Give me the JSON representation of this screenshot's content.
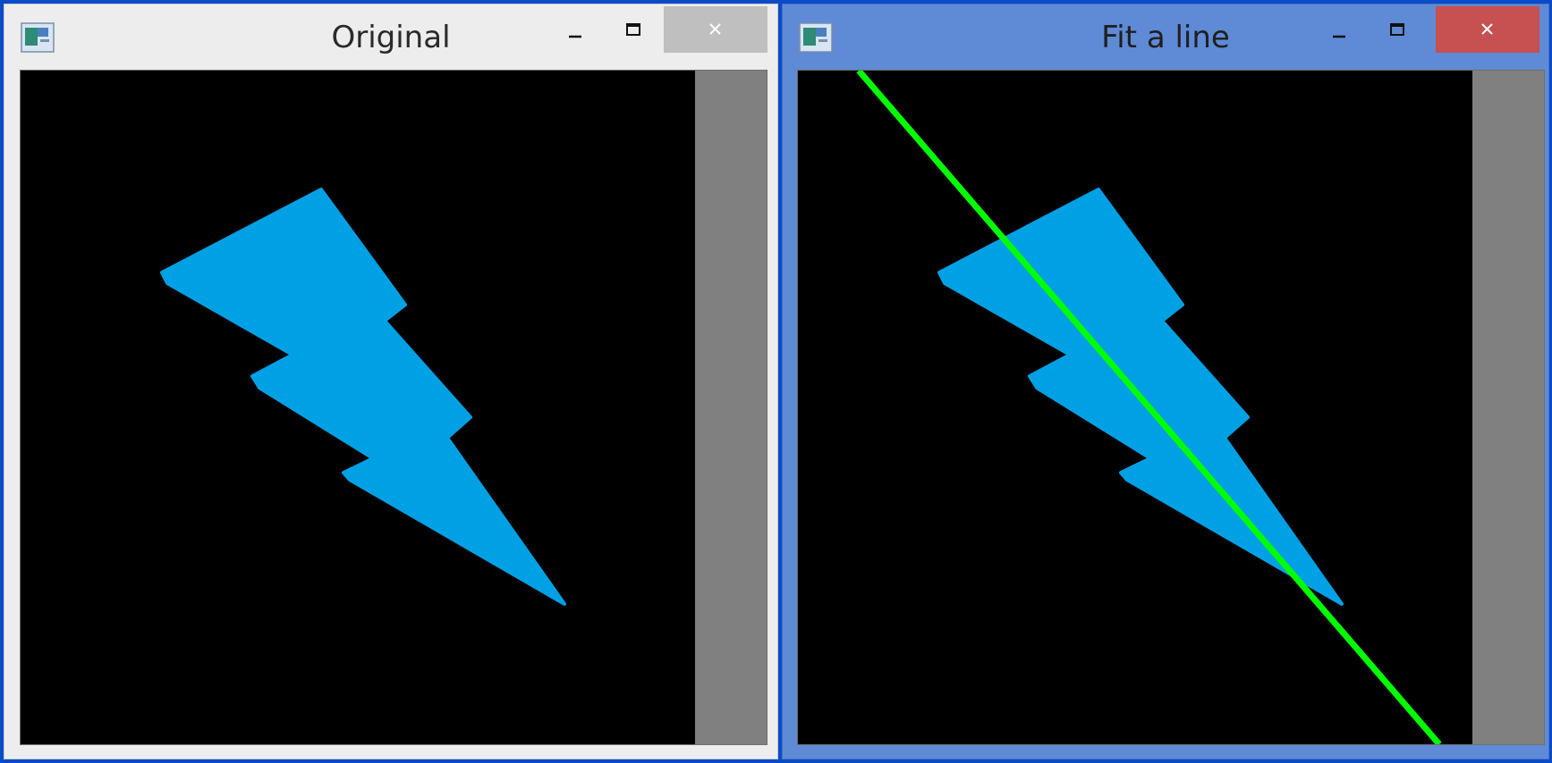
{
  "windows": [
    {
      "title": "Original",
      "icon": "opencv-window-icon",
      "controls": {
        "minimize": "minimize-icon",
        "maximize": "maximize-icon",
        "close": "close-icon"
      }
    },
    {
      "title": "Fit a line",
      "icon": "opencv-window-icon",
      "controls": {
        "minimize": "minimize-icon",
        "maximize": "maximize-icon",
        "close": "close-icon"
      }
    }
  ],
  "colors": {
    "desktop": "#0a4bc8",
    "shape_fill": "#00a0e4",
    "fit_line": "#00ff00",
    "canvas_bg": "#000000",
    "close_active": "#c75050"
  }
}
